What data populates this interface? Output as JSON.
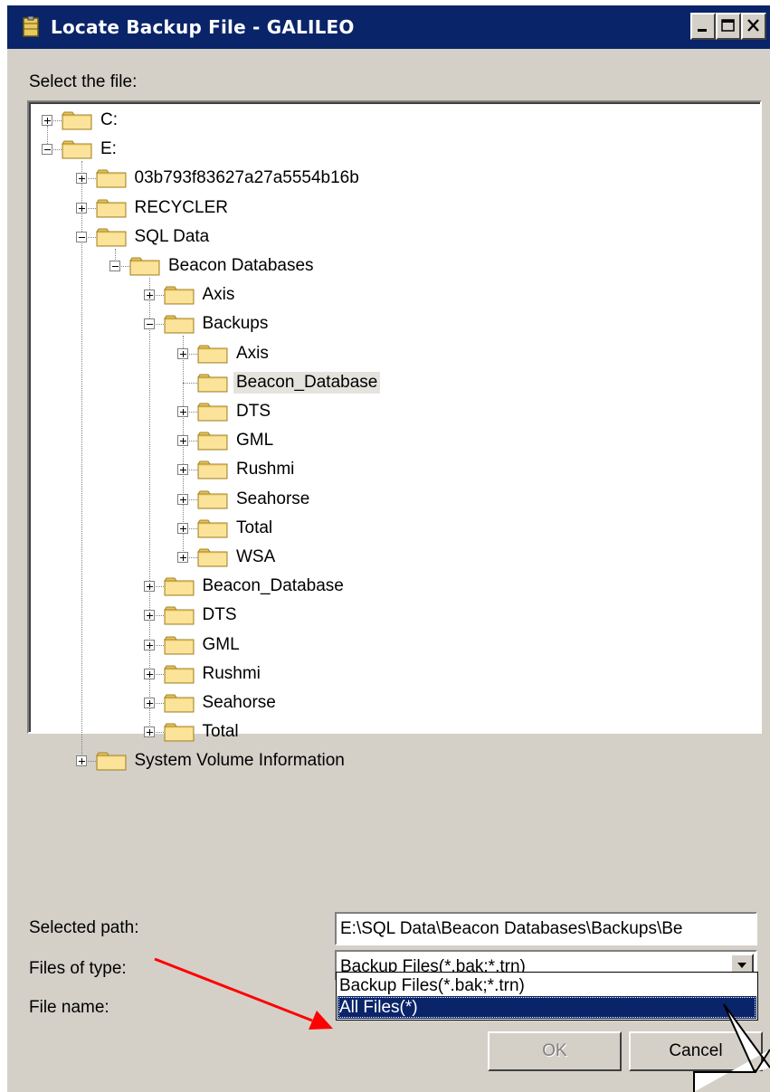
{
  "window": {
    "title": "Locate Backup File - GALILEO",
    "minimize_icon": "minimize-icon",
    "maximize_icon": "maximize-icon",
    "close_icon": "close-icon"
  },
  "labels": {
    "select_file": "Select the file:",
    "selected_path": "Selected path:",
    "files_of_type": "Files of type:",
    "file_name": "File name:"
  },
  "tree": [
    {
      "label": "C:",
      "depth": 0,
      "expander": "plus"
    },
    {
      "label": "E:",
      "depth": 0,
      "expander": "minus"
    },
    {
      "label": "03b793f83627a27a5554b16b",
      "depth": 1,
      "expander": "plus"
    },
    {
      "label": "RECYCLER",
      "depth": 1,
      "expander": "plus"
    },
    {
      "label": "SQL Data",
      "depth": 1,
      "expander": "minus"
    },
    {
      "label": "Beacon Databases",
      "depth": 2,
      "expander": "minus"
    },
    {
      "label": "Axis",
      "depth": 3,
      "expander": "plus"
    },
    {
      "label": "Backups",
      "depth": 3,
      "expander": "minus"
    },
    {
      "label": "Axis",
      "depth": 4,
      "expander": "plus"
    },
    {
      "label": "Beacon_Database",
      "depth": 4,
      "expander": "none",
      "selected": true
    },
    {
      "label": "DTS",
      "depth": 4,
      "expander": "plus"
    },
    {
      "label": "GML",
      "depth": 4,
      "expander": "plus"
    },
    {
      "label": "Rushmi",
      "depth": 4,
      "expander": "plus"
    },
    {
      "label": "Seahorse",
      "depth": 4,
      "expander": "plus"
    },
    {
      "label": "Total",
      "depth": 4,
      "expander": "plus"
    },
    {
      "label": "WSA",
      "depth": 4,
      "expander": "plus"
    },
    {
      "label": "Beacon_Database",
      "depth": 3,
      "expander": "plus"
    },
    {
      "label": "DTS",
      "depth": 3,
      "expander": "plus"
    },
    {
      "label": "GML",
      "depth": 3,
      "expander": "plus"
    },
    {
      "label": "Rushmi",
      "depth": 3,
      "expander": "plus"
    },
    {
      "label": "Seahorse",
      "depth": 3,
      "expander": "plus"
    },
    {
      "label": "Total",
      "depth": 3,
      "expander": "plus"
    },
    {
      "label": "System Volume Information",
      "depth": 1,
      "expander": "plus"
    }
  ],
  "fields": {
    "selected_path_value": "E:\\SQL Data\\Beacon Databases\\Backups\\Be",
    "files_of_type_value": "Backup Files(*.bak;*.trn)",
    "file_type_options": [
      "Backup Files(*.bak;*.trn)",
      "All Files(*)"
    ],
    "highlighted_option": "All Files(*)"
  },
  "buttons": {
    "ok": "OK",
    "cancel": "Cancel",
    "ok_enabled": false
  },
  "colors": {
    "titlebar": "#0a246a",
    "face": "#d4d0c8",
    "folder": "#f5d67a",
    "selection": "#0a246a",
    "annotation_arrow": "#ff0000"
  }
}
